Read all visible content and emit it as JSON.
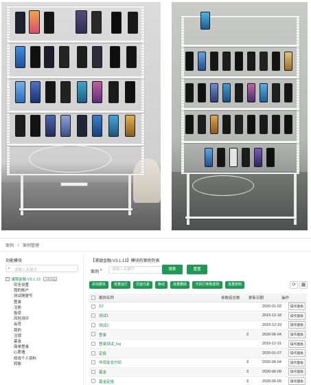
{
  "colors": {
    "accent_green": "#1f9a55",
    "link_green": "#1e8c4e"
  },
  "breadcrumb": [
    "案例",
    "案例管理"
  ],
  "sidebar": {
    "title": "功能模块",
    "search_placeholder": "请输入关键字",
    "root_label": "浦银金融-V3.1.13",
    "root_actions": [
      "+",
      "✎",
      "⊘"
    ],
    "items": [
      "安全设置",
      "我的账户",
      "测试随便写",
      "登录",
      "注册",
      "投资",
      "风险测评",
      "会员",
      "我的",
      "注销",
      "基金",
      "简单登录",
      "心愿墙",
      "修改个人资料",
      "转账"
    ]
  },
  "main": {
    "title": "【浦银金融-V3.1.13】模块的案例列表",
    "select_label": "案例",
    "select_icon": "chevron-down-icon",
    "search_placeholder": "请输入关键字",
    "search_button": "搜索",
    "reset_button": "重置",
    "toolbar": [
      "添加脚本",
      "批量运行",
      "页面元素",
      "移动",
      "批量删除",
      "不执行参数案例",
      "批量复制"
    ],
    "refresh_icon": "⟳",
    "grid_icon": "▦",
    "table": {
      "headers": [
        "案例名称",
        "参数组总数",
        "更新日期",
        "操作"
      ],
      "rows": [
        {
          "name": "ZZ",
          "count": "",
          "date": "2020-01-02",
          "op": "操作面板"
        },
        {
          "name": "测试1",
          "count": "",
          "date": "2019-12-18",
          "op": "操作面板"
        },
        {
          "name": "测试2",
          "count": "",
          "date": "2019-12-19",
          "op": "操作面板"
        },
        {
          "name": "登录",
          "count": "3",
          "date": "2020-06-04",
          "op": "操作面板"
        },
        {
          "name": "登录测试_hej",
          "count": "",
          "date": "2019-12-31",
          "op": "操作面板"
        },
        {
          "name": "定投",
          "count": "",
          "date": "2020-01-07",
          "op": "操作面板"
        },
        {
          "name": "非现金支付码",
          "count": "3",
          "date": "2020-06-04",
          "op": "操作面板"
        },
        {
          "name": "基金",
          "count": "3",
          "date": "2020-06-09",
          "op": "操作面板"
        },
        {
          "name": "基金定投",
          "count": "3",
          "date": "2020-06-09",
          "op": "操作面板"
        }
      ]
    }
  }
}
